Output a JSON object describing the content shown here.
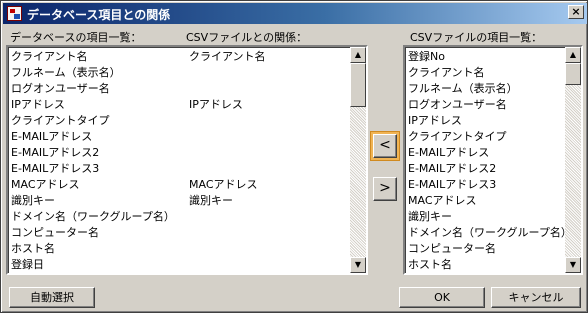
{
  "window": {
    "title": "データベース項目との関係",
    "close_glyph": "×"
  },
  "labels": {
    "db_list": "データベースの項目一覧：",
    "csv_relation": "CSVファイルとの関係：",
    "csv_list": "CSVファイルの項目一覧："
  },
  "db_list": [
    {
      "name": "クライアント名",
      "relation": "クライアント名"
    },
    {
      "name": "フルネーム（表示名）",
      "relation": ""
    },
    {
      "name": "ログオンユーザー名",
      "relation": ""
    },
    {
      "name": "IPアドレス",
      "relation": "IPアドレス"
    },
    {
      "name": "クライアントタイプ",
      "relation": ""
    },
    {
      "name": "E-MAILアドレス",
      "relation": ""
    },
    {
      "name": "E-MAILアドレス2",
      "relation": ""
    },
    {
      "name": "E-MAILアドレス3",
      "relation": ""
    },
    {
      "name": "MACアドレス",
      "relation": "MACアドレス"
    },
    {
      "name": "識別キー",
      "relation": "識別キー"
    },
    {
      "name": "ドメイン名（ワークグループ名）",
      "relation": ""
    },
    {
      "name": "コンピューター名",
      "relation": ""
    },
    {
      "name": "ホスト名",
      "relation": ""
    },
    {
      "name": "登録日",
      "relation": ""
    }
  ],
  "csv_list": [
    "登録No",
    "クライアント名",
    "フルネーム（表示名）",
    "ログオンユーザー名",
    "IPアドレス",
    "クライアントタイプ",
    "E-MAILアドレス",
    "E-MAILアドレス2",
    "E-MAILアドレス3",
    "MACアドレス",
    "識別キー",
    "ドメイン名（ワークグループ名）",
    "コンピューター名",
    "ホスト名"
  ],
  "buttons": {
    "move_left": "<",
    "move_right": ">",
    "auto_select": "自動選択",
    "ok": "OK",
    "cancel": "キャンセル"
  },
  "scroll": {
    "up_glyph": "▲",
    "down_glyph": "▼"
  }
}
